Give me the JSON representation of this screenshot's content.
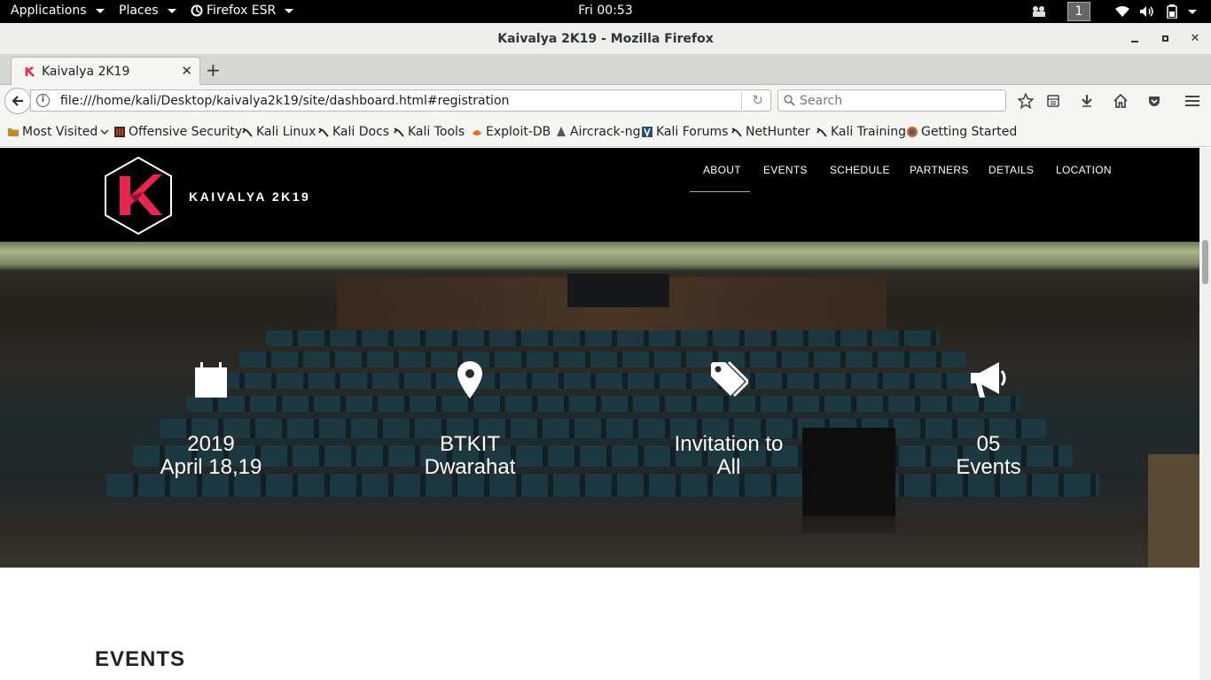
{
  "topbar": {
    "applications": "Applications",
    "places": "Places",
    "browser": "Firefox ESR",
    "clock": "Fri 00:53",
    "workspace": "1"
  },
  "window": {
    "title": "Kaivalya 2K19 - Mozilla Firefox"
  },
  "tab": {
    "title": "Kaivalya 2K19"
  },
  "navbar": {
    "url": "file:///home/kali/Desktop/kaivalya2k19/site/dashboard.html#registration",
    "search_placeholder": "Search"
  },
  "bookmarks": [
    {
      "label": "Most Visited",
      "icon": "star-icon"
    },
    {
      "label": "Offensive Security",
      "icon": "offsec-icon"
    },
    {
      "label": "Kali Linux",
      "icon": "kali-dragon-icon"
    },
    {
      "label": "Kali Docs",
      "icon": "kali-dragon-icon"
    },
    {
      "label": "Kali Tools",
      "icon": "kali-dragon-icon"
    },
    {
      "label": "Exploit-DB",
      "icon": "exploitdb-icon"
    },
    {
      "label": "Aircrack-ng",
      "icon": "aircrack-icon"
    },
    {
      "label": "Kali Forums",
      "icon": "kali-forums-icon"
    },
    {
      "label": "NetHunter",
      "icon": "kali-dragon-icon"
    },
    {
      "label": "Kali Training",
      "icon": "kali-dragon-icon"
    },
    {
      "label": "Getting Started",
      "icon": "firefox-icon"
    }
  ],
  "site": {
    "brand": "KAIVALYA 2K19",
    "nav": [
      "ABOUT",
      "EVENTS",
      "SCHEDULE",
      "PARTNERS",
      "DETAILS",
      "LOCATION"
    ],
    "active_nav": "ABOUT",
    "accent_color": "#e8244f",
    "stats": [
      {
        "icon": "calendar-icon",
        "line1": "2019",
        "line2": "April 18,19"
      },
      {
        "icon": "map-marker-icon",
        "line1": "BTKIT",
        "line2": "Dwarahat"
      },
      {
        "icon": "tags-icon",
        "line1": "Invitation to",
        "line2": "All"
      },
      {
        "icon": "megaphone-icon",
        "line1": "05",
        "line2": "Events"
      }
    ],
    "events_heading": "EVENTS"
  }
}
